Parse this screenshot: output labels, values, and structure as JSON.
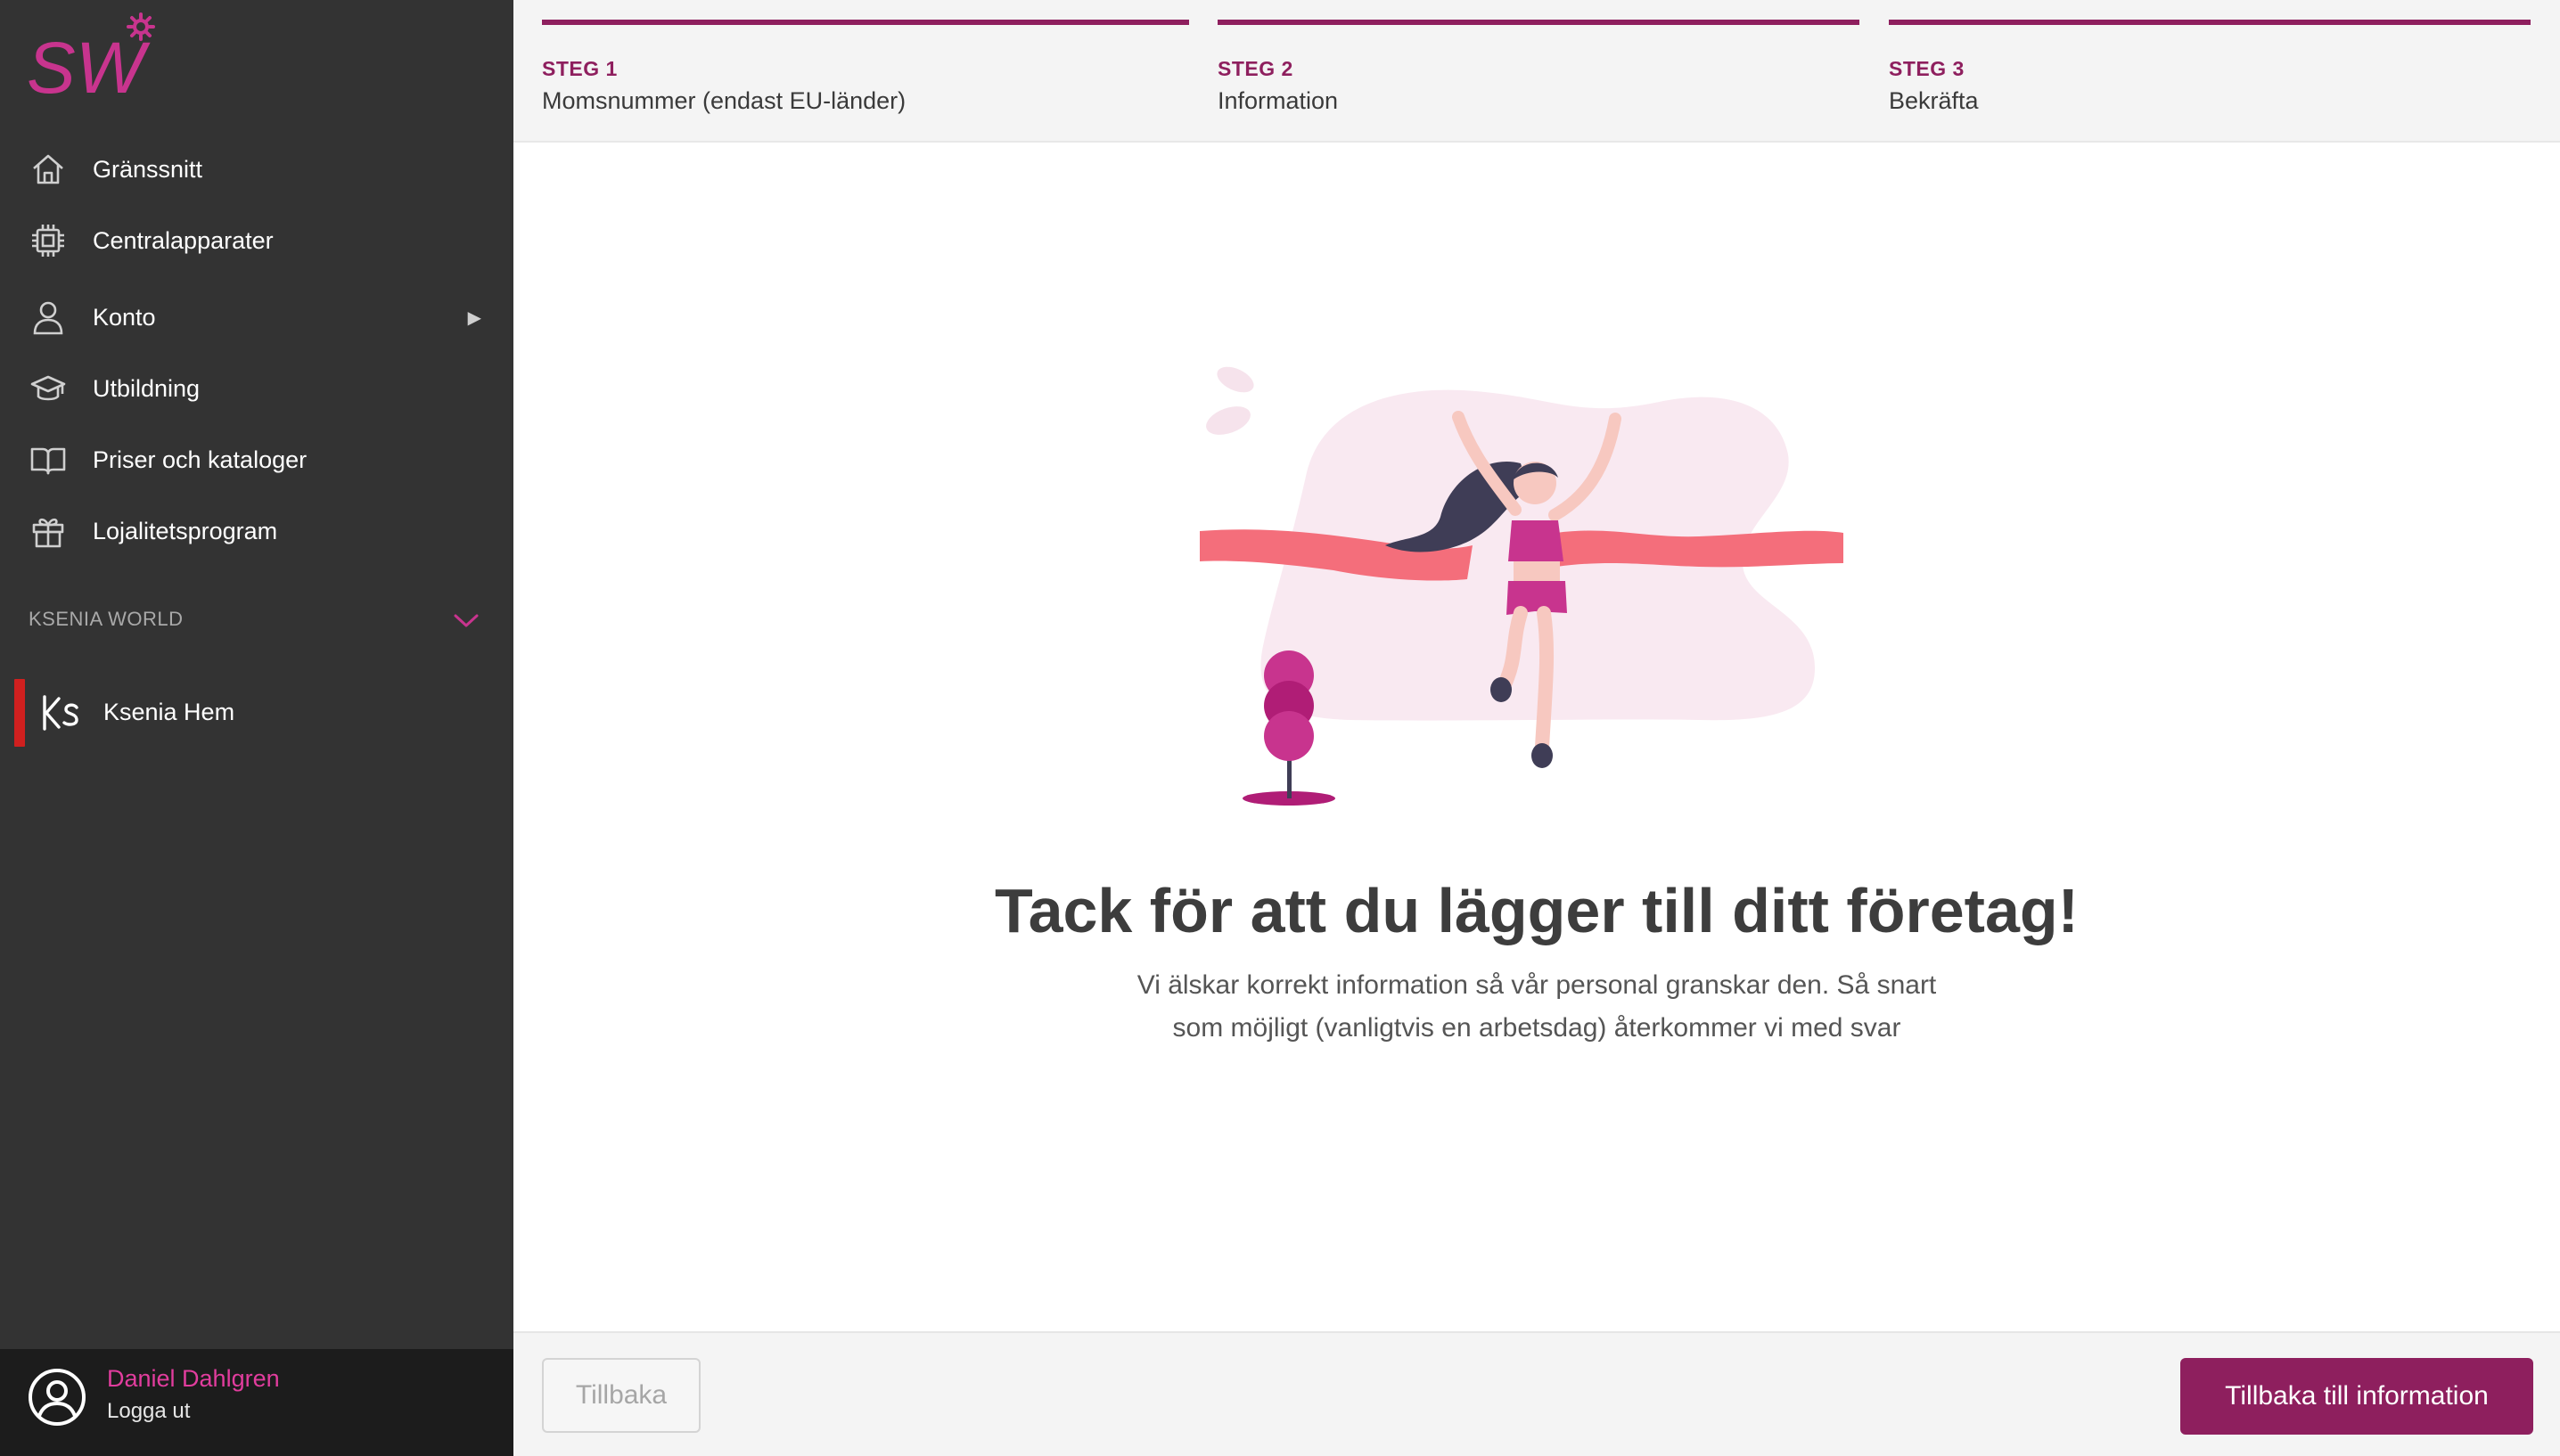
{
  "brand": {
    "logo_text": "SW",
    "accent_color": "#8e1f5e",
    "logo_color": "#c8348e"
  },
  "sidebar": {
    "items": [
      {
        "label": "Gränssnitt",
        "icon": "home-icon"
      },
      {
        "label": "Centralapparater",
        "icon": "chip-icon"
      },
      {
        "label": "Konto",
        "icon": "user-icon",
        "has_submenu": true
      },
      {
        "label": "Utbildning",
        "icon": "graduation-cap-icon"
      },
      {
        "label": "Priser och kataloger",
        "icon": "book-icon"
      },
      {
        "label": "Lojalitetsprogram",
        "icon": "gift-icon"
      }
    ],
    "submenu_caret": "▶",
    "section": {
      "label": "KSENIA WORLD",
      "icon": "chevron-down-icon"
    },
    "app_item": {
      "label": "Ksenia Hem",
      "icon": "ks-logo-icon"
    },
    "user": {
      "name": "Daniel Dahlgren",
      "logout": "Logga ut",
      "icon": "avatar-icon"
    }
  },
  "stepper": {
    "steps": [
      {
        "number": "STEG 1",
        "title": "Momsnummer (endast EU-länder)"
      },
      {
        "number": "STEG 2",
        "title": "Information"
      },
      {
        "number": "STEG 3",
        "title": "Bekräfta"
      }
    ]
  },
  "content": {
    "heading": "Tack för att du lägger till ditt företag!",
    "description": "Vi älskar korrekt information så vår personal granskar den. Så snart som möjligt (vanligtvis en arbetsdag) återkommer vi med svar",
    "illustration": "finish-line-runner-illustration"
  },
  "footer": {
    "back_label": "Tillbaka",
    "primary_label": "Tillbaka till information"
  }
}
